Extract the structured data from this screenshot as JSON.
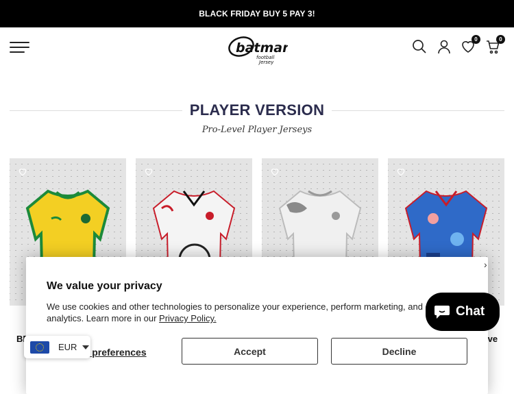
{
  "announcement": "BLACK FRIDAY BUY 5 PAY 3!",
  "header": {
    "logo_text": "batman",
    "logo_sub": "football jersey",
    "wishlist_count": "0",
    "cart_count": "0"
  },
  "section": {
    "title": "PLAYER VERSION",
    "subtitle": "Pro-Level Player Jerseys"
  },
  "products": [
    {
      "name": "BR",
      "shirt_color": "#f3cf23",
      "trim_color": "#1c8a3a"
    },
    {
      "name": "",
      "shirt_color": "#f4f4f4",
      "trim_color": "#c81d2a"
    },
    {
      "name": "",
      "shirt_color": "#f0f0f0",
      "trim_color": "#8a8a8a"
    },
    {
      "name": "ive",
      "shirt_color": "#2f6ac8",
      "trim_color": "#c81d2a"
    }
  ],
  "cookie": {
    "title": "We value your privacy",
    "body": "We use cookies and other technologies to personalize your experience, perform marketing, and collect analytics. Learn more in our",
    "policy_link": "Privacy Policy.",
    "preferences_link": "ge preferences",
    "accept_label": "Accept",
    "decline_label": "Decline"
  },
  "currency": {
    "code": "EUR",
    "flag": "eu-flag-icon"
  },
  "chat": {
    "label": "Chat"
  }
}
